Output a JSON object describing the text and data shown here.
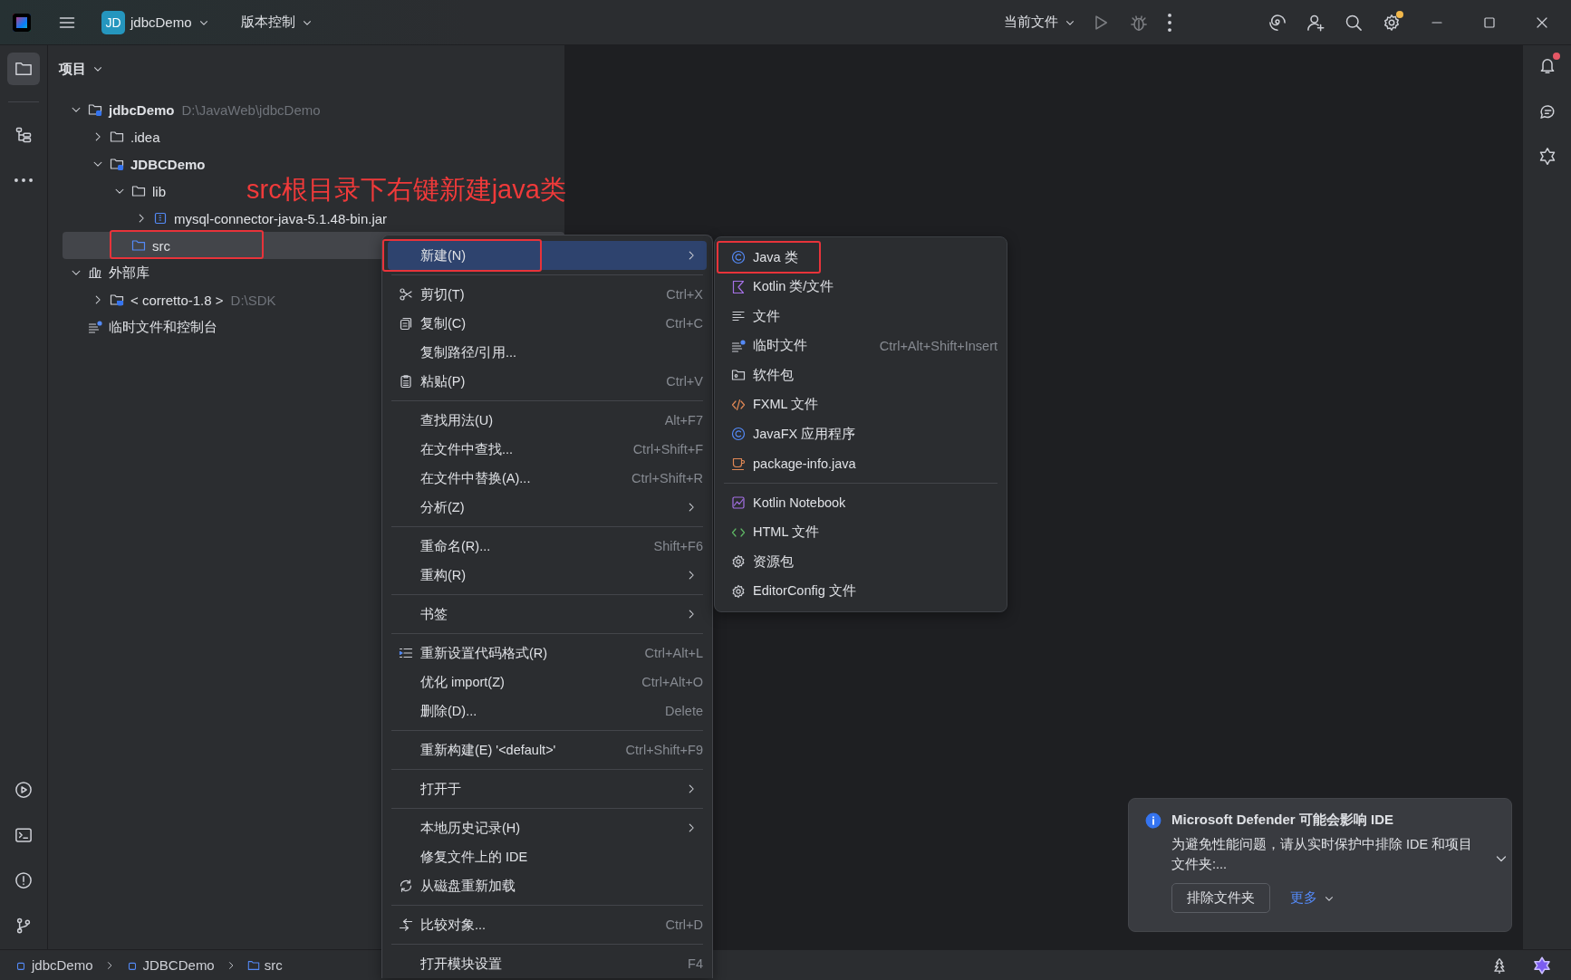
{
  "title_bar": {
    "project_badge": "JD",
    "project": "jdbcDemo",
    "vcs": "版本控制",
    "run_config": "当前文件",
    "settings_update": true
  },
  "left_toolbar": [
    {
      "selected": true
    },
    {
      "selected": false
    },
    {
      "selected": false
    }
  ],
  "right_toolbar": [
    {
      "badge": true
    },
    {
      "badge": false
    },
    {
      "badge": false
    }
  ],
  "project_panel": {
    "title": "项目",
    "tree": [
      {
        "label": "jdbcDemo",
        "path": "D:\\JavaWeb\\jdbcDemo",
        "kind": "module",
        "bold": true,
        "expanded": true,
        "selected": false,
        "children": [
          {
            "label": ".idea",
            "kind": "folder",
            "expanded": false,
            "selected": false
          },
          {
            "label": "JDBCDemo",
            "kind": "module",
            "bold": true,
            "expanded": true,
            "selected": false,
            "children": [
              {
                "label": "lib",
                "kind": "folder",
                "expanded": true,
                "selected": false,
                "children": [
                  {
                    "label": "mysql-connector-java-5.1.48-bin.jar",
                    "kind": "jar",
                    "expanded": false,
                    "selected": false
                  }
                ]
              },
              {
                "label": "src",
                "kind": "source",
                "selected": true,
                "annotated": true
              }
            ]
          }
        ]
      },
      {
        "label": "外部库",
        "kind": "library",
        "expanded": true,
        "selected": false,
        "children": [
          {
            "label": "< corretto-1.8 >",
            "path": "D:\\SDK",
            "kind": "jdk",
            "expanded": false,
            "selected": false
          }
        ]
      },
      {
        "label": "临时文件和控制台",
        "kind": "scratch",
        "selected": false
      }
    ]
  },
  "annotation": {
    "text": "src根目录下右键新建java类"
  },
  "context_menu": [
    {
      "kind": "item",
      "label": "新建(N)",
      "submenu": true,
      "selected": true,
      "annotated": true
    },
    {
      "kind": "separator"
    },
    {
      "kind": "item",
      "label": "剪切(T)",
      "shortcut": "Ctrl+X",
      "selected": false
    },
    {
      "kind": "item",
      "label": "复制(C)",
      "shortcut": "Ctrl+C",
      "selected": false
    },
    {
      "kind": "item",
      "label": "复制路径/引用...",
      "selected": false
    },
    {
      "kind": "item",
      "label": "粘贴(P)",
      "shortcut": "Ctrl+V",
      "selected": false
    },
    {
      "kind": "separator"
    },
    {
      "kind": "item",
      "label": "查找用法(U)",
      "shortcut": "Alt+F7",
      "selected": false
    },
    {
      "kind": "item",
      "label": "在文件中查找...",
      "shortcut": "Ctrl+Shift+F",
      "selected": false
    },
    {
      "kind": "item",
      "label": "在文件中替换(A)...",
      "shortcut": "Ctrl+Shift+R",
      "selected": false
    },
    {
      "kind": "item",
      "label": "分析(Z)",
      "submenu": true,
      "selected": false
    },
    {
      "kind": "separator"
    },
    {
      "kind": "item",
      "label": "重命名(R)...",
      "shortcut": "Shift+F6",
      "selected": false
    },
    {
      "kind": "item",
      "label": "重构(R)",
      "submenu": true,
      "selected": false
    },
    {
      "kind": "separator"
    },
    {
      "kind": "item",
      "label": "书签",
      "submenu": true,
      "selected": false
    },
    {
      "kind": "separator"
    },
    {
      "kind": "item",
      "label": "重新设置代码格式(R)",
      "shortcut": "Ctrl+Alt+L",
      "selected": false
    },
    {
      "kind": "item",
      "label": "优化 import(Z)",
      "shortcut": "Ctrl+Alt+O",
      "selected": false
    },
    {
      "kind": "item",
      "label": "删除(D)...",
      "shortcut": "Delete",
      "selected": false
    },
    {
      "kind": "separator"
    },
    {
      "kind": "item",
      "label": "重新构建(E) '<default>'",
      "shortcut": "Ctrl+Shift+F9",
      "selected": false
    },
    {
      "kind": "separator"
    },
    {
      "kind": "item",
      "label": "打开于",
      "submenu": true,
      "selected": false
    },
    {
      "kind": "separator"
    },
    {
      "kind": "item",
      "label": "本地历史记录(H)",
      "submenu": true,
      "selected": false
    },
    {
      "kind": "item",
      "label": "修复文件上的 IDE",
      "selected": false
    },
    {
      "kind": "item",
      "label": "从磁盘重新加载",
      "selected": false
    },
    {
      "kind": "separator"
    },
    {
      "kind": "item",
      "label": "比较对象...",
      "shortcut": "Ctrl+D",
      "selected": false
    },
    {
      "kind": "separator"
    },
    {
      "kind": "item",
      "label": "打开模块设置",
      "shortcut": "F4",
      "selected": false
    }
  ],
  "new_submenu": [
    {
      "kind": "item",
      "label": "Java 类",
      "selected": false,
      "annotated": true
    },
    {
      "kind": "item",
      "label": "Kotlin 类/文件",
      "selected": false
    },
    {
      "kind": "item",
      "label": "文件",
      "selected": false
    },
    {
      "kind": "item",
      "label": "临时文件",
      "shortcut": "Ctrl+Alt+Shift+Insert",
      "selected": false
    },
    {
      "kind": "item",
      "label": "软件包",
      "selected": false
    },
    {
      "kind": "item",
      "label": "FXML 文件",
      "selected": false
    },
    {
      "kind": "item",
      "label": "JavaFX 应用程序",
      "selected": false
    },
    {
      "kind": "item",
      "label": "package-info.java",
      "selected": false
    },
    {
      "kind": "separator"
    },
    {
      "kind": "item",
      "label": "Kotlin Notebook",
      "selected": false
    },
    {
      "kind": "item",
      "label": "HTML 文件",
      "selected": false
    },
    {
      "kind": "item",
      "label": "资源包",
      "selected": false
    },
    {
      "kind": "item",
      "label": "EditorConfig 文件",
      "selected": false
    }
  ],
  "notification": {
    "title": "Microsoft Defender 可能会影响 IDE",
    "body": "为避免性能问题，请从实时保护中排除 IDE 和项目文件夹:...",
    "button": "排除文件夹",
    "link": "更多"
  },
  "status_bar": {
    "breadcrumbs": [
      {
        "label": "jdbcDemo",
        "kind": "module"
      },
      {
        "label": "JDBCDemo",
        "kind": "module"
      },
      {
        "label": "src",
        "kind": "folder"
      }
    ]
  }
}
